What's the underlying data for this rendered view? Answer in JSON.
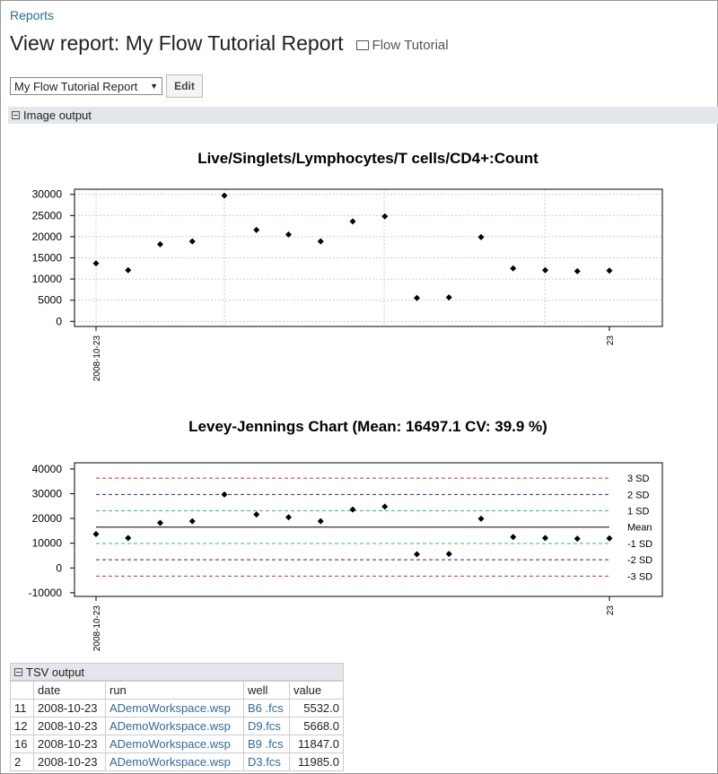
{
  "breadcrumb": "Reports",
  "page_title": "View report: My Flow Tutorial Report",
  "folder_label": "Flow Tutorial",
  "report_select": {
    "value": "My Flow Tutorial Report"
  },
  "edit_label": "Edit",
  "image_section_label": "Image output",
  "tsv_section_label": "TSV output",
  "chart_data": [
    {
      "type": "scatter",
      "title": "Live/Singlets/Lymphocytes/T cells/CD4+:Count",
      "x_ticks": [
        "2008-10-23",
        "23"
      ],
      "yticks": [
        0,
        5000,
        10000,
        15000,
        20000,
        25000,
        30000
      ],
      "ylim": [
        -1200,
        31200
      ],
      "grid": true,
      "values": [
        13700,
        12100,
        18200,
        18900,
        29700,
        21600,
        20500,
        18900,
        23600,
        24800,
        5532,
        5668,
        19900,
        12500,
        12100,
        11847,
        11985
      ]
    },
    {
      "type": "scatter",
      "title": "Levey-Jennings Chart (Mean: 16497.1 CV: 39.9 %)",
      "x_ticks": [
        "2008-10-23",
        "23"
      ],
      "yticks": [
        -10000,
        0,
        10000,
        20000,
        30000,
        40000
      ],
      "ylim": [
        -11500,
        42500
      ],
      "values": [
        13700,
        12100,
        18200,
        18900,
        29700,
        21600,
        20500,
        18900,
        23600,
        24800,
        5532,
        5668,
        19900,
        12500,
        12100,
        11847,
        11985
      ],
      "reference_lines": [
        {
          "label": "3 SD",
          "value": 36300,
          "color": "#d03030",
          "dash": true
        },
        {
          "label": "2 SD",
          "value": 29700,
          "color": "#2a2a90",
          "dash": true
        },
        {
          "label": "1 SD",
          "value": 23100,
          "color": "#30c060",
          "dash": true
        },
        {
          "label": "Mean",
          "value": 16497.1,
          "color": "#000000",
          "dash": false
        },
        {
          "label": "-1 SD",
          "value": 9900,
          "color": "#30c060",
          "dash": true
        },
        {
          "label": "-2 SD",
          "value": 3300,
          "color": "#2a2a90",
          "dash": true
        },
        {
          "label": "-3 SD",
          "value": -3300,
          "color": "#d03030",
          "dash": true
        }
      ]
    }
  ],
  "tsv": {
    "columns": [
      "",
      "date",
      "run",
      "well",
      "value"
    ],
    "rows": [
      [
        "11",
        "2008-10-23",
        "ADemoWorkspace.wsp",
        "B6 .fcs",
        "5532.0"
      ],
      [
        "12",
        "2008-10-23",
        "ADemoWorkspace.wsp",
        "D9.fcs",
        "5668.0"
      ],
      [
        "16",
        "2008-10-23",
        "ADemoWorkspace.wsp",
        "B9 .fcs",
        "11847.0"
      ],
      [
        "2",
        "2008-10-23",
        "ADemoWorkspace.wsp",
        "D3.fcs",
        "11985.0"
      ]
    ]
  }
}
